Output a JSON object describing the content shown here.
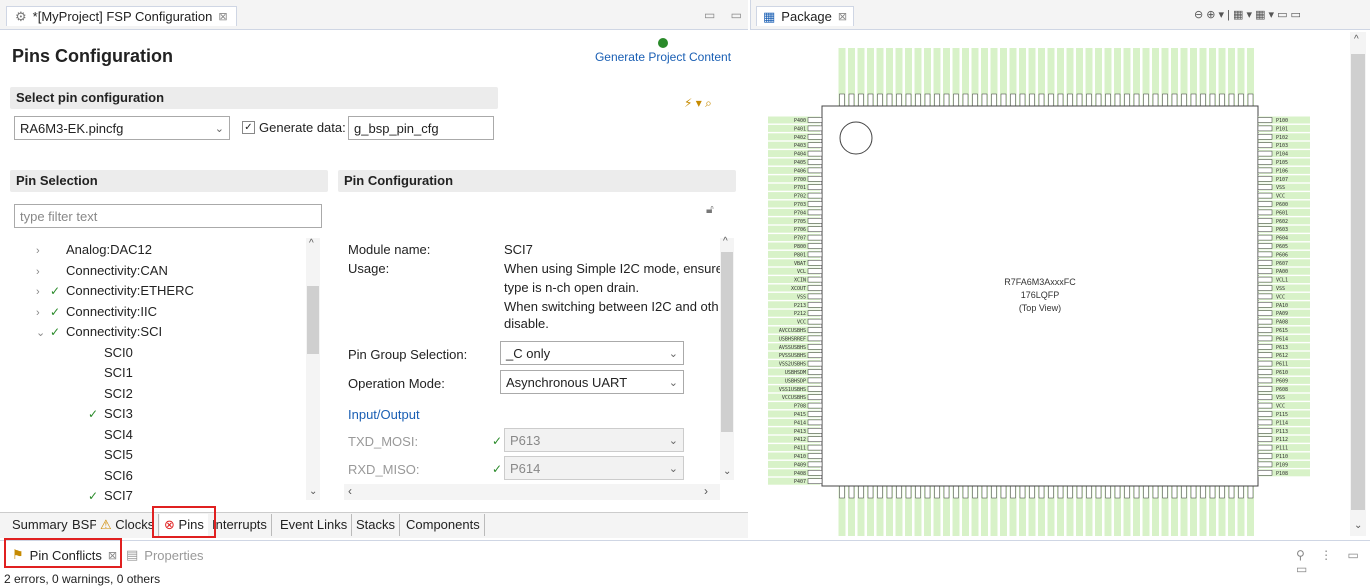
{
  "left_tab": {
    "title": "*[MyProject] FSP Configuration",
    "close": "⊠"
  },
  "right_tab": {
    "title": "Package",
    "close": "⊠"
  },
  "pins_config_title": "Pins Configuration",
  "generate_project": "Generate Project Content",
  "select_pin_config": {
    "header": "Select pin configuration",
    "value": "RA6M3-EK.pincfg",
    "generate_label": "Generate data:",
    "generate_value": "g_bsp_pin_cfg"
  },
  "pin_selection": {
    "header": "Pin Selection",
    "filter_placeholder": "type filter text",
    "items": [
      {
        "label": "Analog:DAC12",
        "chev": "›",
        "check": ""
      },
      {
        "label": "Connectivity:CAN",
        "chev": "›",
        "check": ""
      },
      {
        "label": "Connectivity:ETHERC",
        "chev": "›",
        "check": "✓"
      },
      {
        "label": "Connectivity:IIC",
        "chev": "›",
        "check": "✓"
      },
      {
        "label": "Connectivity:SCI",
        "chev": "⌄",
        "check": "✓"
      },
      {
        "label": "SCI0",
        "chev": "",
        "check": ""
      },
      {
        "label": "SCI1",
        "chev": "",
        "check": ""
      },
      {
        "label": "SCI2",
        "chev": "",
        "check": ""
      },
      {
        "label": "SCI3",
        "chev": "",
        "check": "✓"
      },
      {
        "label": "SCI4",
        "chev": "",
        "check": ""
      },
      {
        "label": "SCI5",
        "chev": "",
        "check": ""
      },
      {
        "label": "SCI6",
        "chev": "",
        "check": ""
      },
      {
        "label": "SCI7",
        "chev": "",
        "check": "✓"
      }
    ]
  },
  "pin_config": {
    "header": "Pin Configuration",
    "module_label": "Module name:",
    "module_value": "SCI7",
    "usage_label": "Usage:",
    "usage_lines": [
      "When using Simple I2C mode, ensure",
      "type is n-ch open drain.",
      "When switching between I2C and oth",
      "disable."
    ],
    "group_label": "Pin Group Selection:",
    "group_value": "_C only",
    "mode_label": "Operation Mode:",
    "mode_value": "Asynchronous UART",
    "io_label": "Input/Output",
    "txd_label": "TXD_MOSI:",
    "txd_value": "P613",
    "rxd_label": "RXD_MISO:",
    "rxd_value": "P614"
  },
  "bottom_tabs": [
    "Summary",
    "BSP",
    "Clocks",
    "Pins",
    "Interrupts",
    "Event Links",
    "Stacks",
    "Components"
  ],
  "conflicts": {
    "tab": "Pin Conflicts",
    "props": "Properties",
    "status": "2 errors, 0 warnings, 0 others"
  },
  "chip": {
    "name": "R7FA6M3AxxxFC",
    "pkg": "176LQFP",
    "view": "(Top View)",
    "left_pins": [
      "P400",
      "P401",
      "P402",
      "P403",
      "P404",
      "P405",
      "P406",
      "P700",
      "P701",
      "P702",
      "P703",
      "P704",
      "P705",
      "P706",
      "P707",
      "P800",
      "P801",
      "VBAT",
      "VCL",
      "XCIN",
      "XCOUT",
      "VSS",
      "P213",
      "P212",
      "VCC",
      "AVCCUSBHS",
      "USBHSRREF",
      "AVSSUSBHS",
      "PVSSUSBHS",
      "VSS2USBHS",
      "USBHSDM",
      "USBHSDP",
      "VSS1USBHS",
      "VCCUSBHS",
      "P708",
      "P415",
      "P414",
      "P413",
      "P412",
      "P411",
      "P410",
      "P409",
      "P408",
      "P407"
    ],
    "right_pins": [
      "P100",
      "P101",
      "P102",
      "P103",
      "P104",
      "P105",
      "P106",
      "P107",
      "VSS",
      "VCC",
      "P600",
      "P601",
      "P602",
      "P603",
      "P604",
      "P605",
      "P606",
      "P607",
      "PA00",
      "VCL1",
      "VSS",
      "VCC",
      "PA10",
      "PA09",
      "PA08",
      "P615",
      "P614",
      "P613",
      "P612",
      "P611",
      "P610",
      "P609",
      "P608",
      "VSS",
      "VCC",
      "P115",
      "P114",
      "P113",
      "P112",
      "P111",
      "P110",
      "P109",
      "P108"
    ]
  },
  "colors": {
    "pin_green": "#d8f2c8",
    "error_red": "#e02020",
    "link_blue": "#1a5fb4"
  }
}
